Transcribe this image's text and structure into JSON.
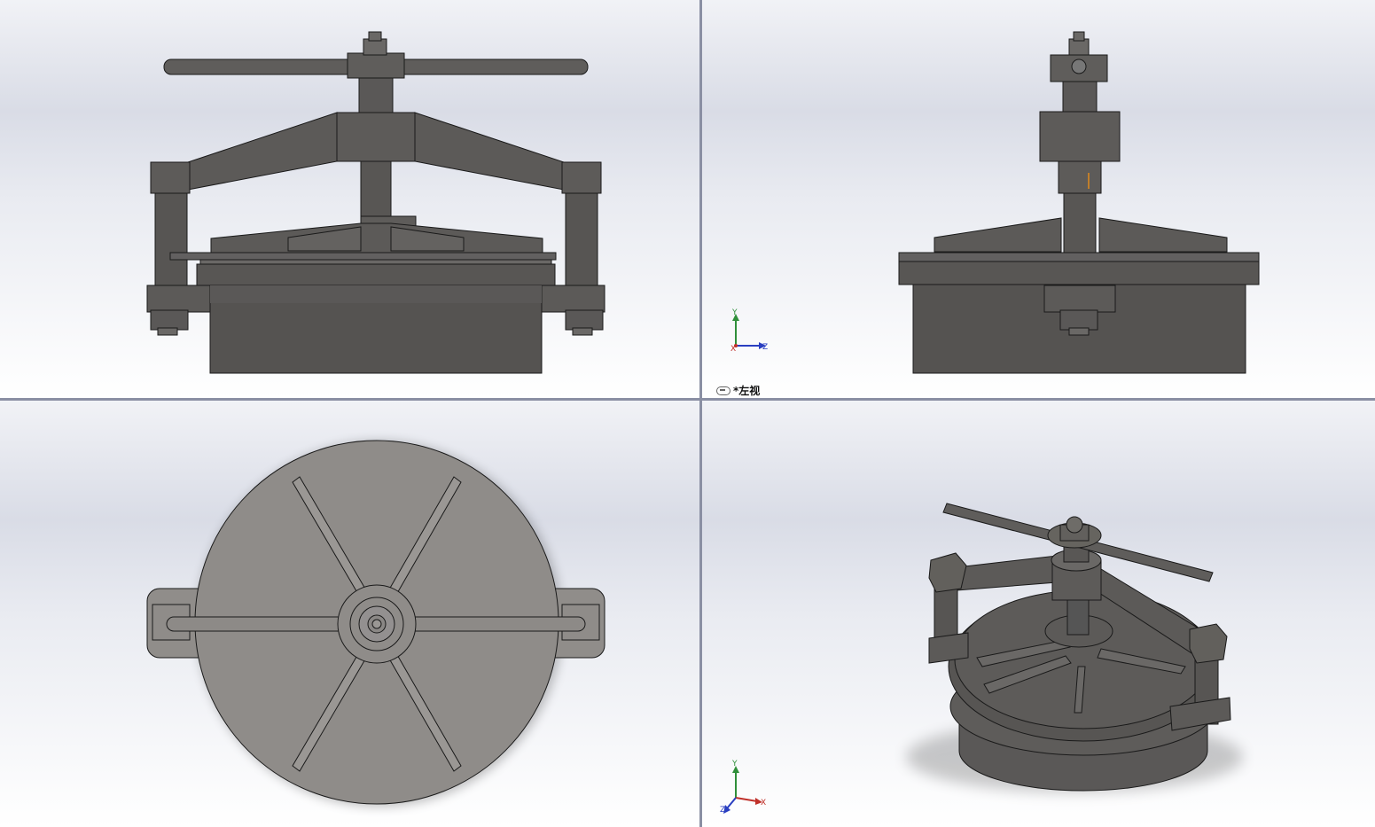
{
  "viewports": {
    "front": {
      "label": ""
    },
    "left": {
      "label": "*左视"
    },
    "top": {
      "label": ""
    },
    "iso": {
      "label": ""
    }
  },
  "triad": {
    "x": "X",
    "y": "Y",
    "z": "Z"
  },
  "icons": {
    "display_state": "link-icon",
    "triad": "axis-triad-icon"
  },
  "colors": {
    "metal": "#5a5857",
    "metal_light": "#8f8c89",
    "edge": "#1a1a1a",
    "x_axis": "#c0312b",
    "y_axis": "#2f8f3a",
    "z_axis": "#2a3fc1",
    "background_top": "#d9dce6"
  }
}
